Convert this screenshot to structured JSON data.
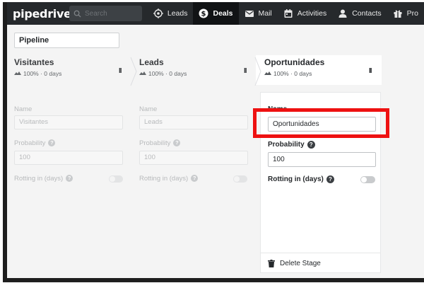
{
  "app": {
    "logo_text": "pipedrive"
  },
  "search": {
    "placeholder": "Search"
  },
  "nav": [
    {
      "label": "Leads",
      "icon": "target-icon",
      "active": false
    },
    {
      "label": "Deals",
      "icon": "dollar-icon",
      "active": true
    },
    {
      "label": "Mail",
      "icon": "mail-icon",
      "active": false
    },
    {
      "label": "Activities",
      "icon": "calendar-icon",
      "active": false
    },
    {
      "label": "Contacts",
      "icon": "person-icon",
      "active": false
    },
    {
      "label": "Pro",
      "icon": "gift-icon",
      "active": false
    }
  ],
  "pipeline": {
    "name_value": "Pipeline"
  },
  "stages": [
    {
      "title": "Visitantes",
      "meta": "100% · 0 days",
      "name_label": "Name",
      "name_value": "Visitantes",
      "probability_label": "Probability",
      "probability_value": "100",
      "rotting_label": "Rotting in (days)",
      "rotting_enabled": false
    },
    {
      "title": "Leads",
      "meta": "100% · 0 days",
      "name_label": "Name",
      "name_value": "Leads",
      "probability_label": "Probability",
      "probability_value": "100",
      "rotting_label": "Rotting in (days)",
      "rotting_enabled": false
    },
    {
      "title": "Oportunidades",
      "meta": "100% · 0 days",
      "name_label": "Name",
      "name_value": "Oportunidades",
      "probability_label": "Probability",
      "probability_value": "100",
      "rotting_label": "Rotting in (days)",
      "rotting_enabled": false,
      "delete_label": "Delete Stage"
    }
  ],
  "drag_handle": "II",
  "help_glyph": "?",
  "colors": {
    "topbar": "#26292c",
    "highlight": "#ee1111",
    "active_nav": "#111315"
  }
}
